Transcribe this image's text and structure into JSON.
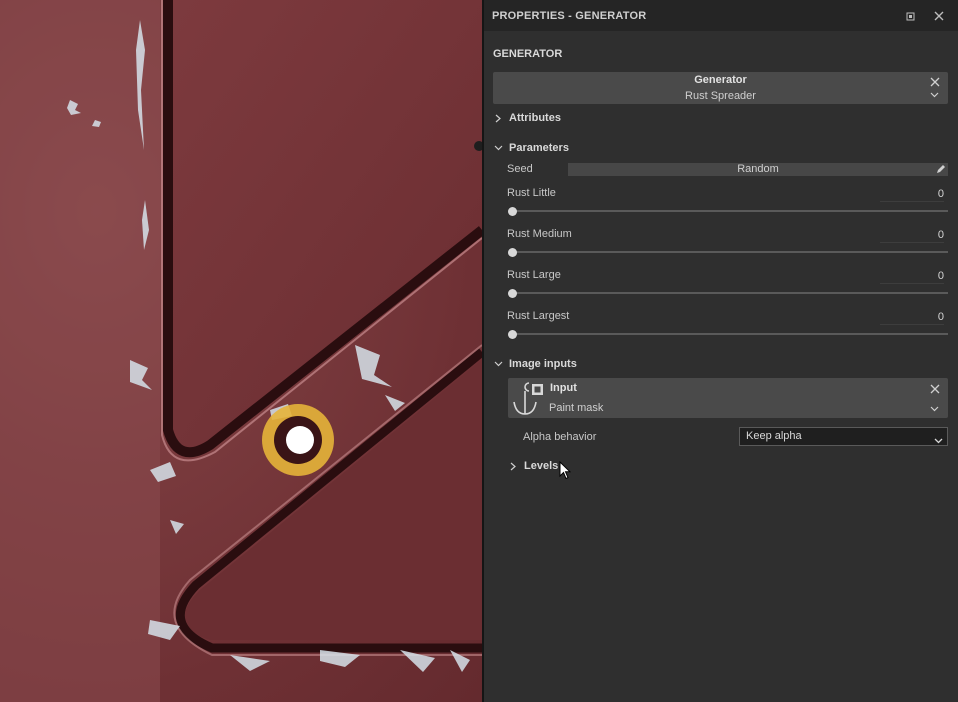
{
  "panel": {
    "title": "PROPERTIES - GENERATOR",
    "section_title": "GENERATOR",
    "generator": {
      "title": "Generator",
      "name": "Rust Spreader"
    },
    "groups": {
      "attributes": "Attributes",
      "parameters": "Parameters",
      "image_inputs": "Image inputs",
      "levels": "Levels"
    },
    "seed": {
      "label": "Seed",
      "value": "Random"
    },
    "params": [
      {
        "label": "Rust Little",
        "value": "0",
        "fraction": 0
      },
      {
        "label": "Rust Medium",
        "value": "0",
        "fraction": 0
      },
      {
        "label": "Rust Large",
        "value": "0",
        "fraction": 0
      },
      {
        "label": "Rust Largest",
        "value": "0",
        "fraction": 0
      }
    ],
    "image_input": {
      "title": "Input",
      "name": "Paint mask"
    },
    "alpha": {
      "label": "Alpha behavior",
      "value": "Keep alpha"
    }
  },
  "colors": {
    "panel_bg": "#2f2f2f",
    "titlebar_bg": "#252525",
    "card_bg": "#4a4a4a",
    "paint_red": "#7a3b3e",
    "highlight_yellow": "#e6b43a"
  }
}
